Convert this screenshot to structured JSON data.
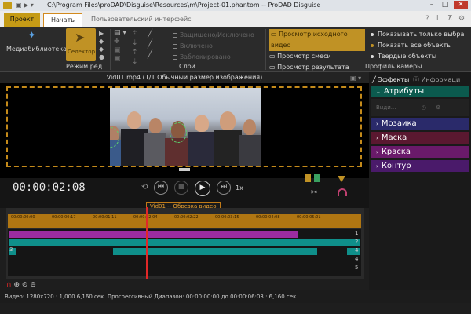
{
  "window": {
    "title": "C:\\Program Files\\proDAD\\Disguise\\Resources\\m\\Project-01.phantom -- ProDAD Disguise"
  },
  "tabs": {
    "project": "Проект",
    "start": "Начать",
    "ui": "Пользовательский интерфейс"
  },
  "ribbon": {
    "media_library": "Медиабиблиотека",
    "selector": "Селектор",
    "edit_mode": "Режим ред...",
    "layer_group": "Слой",
    "checkbox_protected": "Защищено/Исключено",
    "checkbox_enabled": "Включено",
    "checkbox_locked": "Заблокировано",
    "view_source": "Просмотр исходного видео",
    "view_mix": "Просмотр смеси",
    "view_result": "Просмотр результата",
    "show_selected": "Показывать только выбра",
    "show_all": "Показать все объекты",
    "solid_objects": "Твердые объекты",
    "camera_profile": "Профиль камеры"
  },
  "preview": {
    "title": "Vid01.mp4   (1/1  Обычный размер изображения)"
  },
  "transport": {
    "timecode": "00:00:02:08",
    "speed": "1x"
  },
  "clip_tooltip": "Vid01 -- Обрезка видео",
  "ruler_ticks": [
    "00:00:00:00",
    "00:00:00:17",
    "00:00:01:11",
    "00:00:02:04",
    "00:00:02:22",
    "00:00:03:15",
    "00:00:04:08",
    "00:00:05:01"
  ],
  "playhead_fraction": 0.39,
  "track_numbers": [
    "1",
    "2",
    "3",
    "4",
    "4",
    "5",
    "5"
  ],
  "status": {
    "video": "Видео: 1280x720 : 1,000   6,160 сек.   Прогрессивный   Диапазон: 00:00:00:00 до 00:00:06:03 : 6,160 сек."
  },
  "side": {
    "tab_effects": "Эффекты",
    "tab_info": "Информаци",
    "attributes": "Атрибуты",
    "visible_label": "Види...",
    "mosaic": "Мозаика",
    "mask": "Маска",
    "paint": "Краска",
    "contour": "Контур"
  },
  "colors": {
    "accent": "#c09225",
    "teal": "#0f8f8a",
    "purple": "#9b2ca0",
    "mosaic": "#2a2a6a",
    "mask": "#5a1830",
    "paint": "#6a1a6a",
    "contour": "#4a1a6a",
    "attributes": "#0b5a4e"
  }
}
